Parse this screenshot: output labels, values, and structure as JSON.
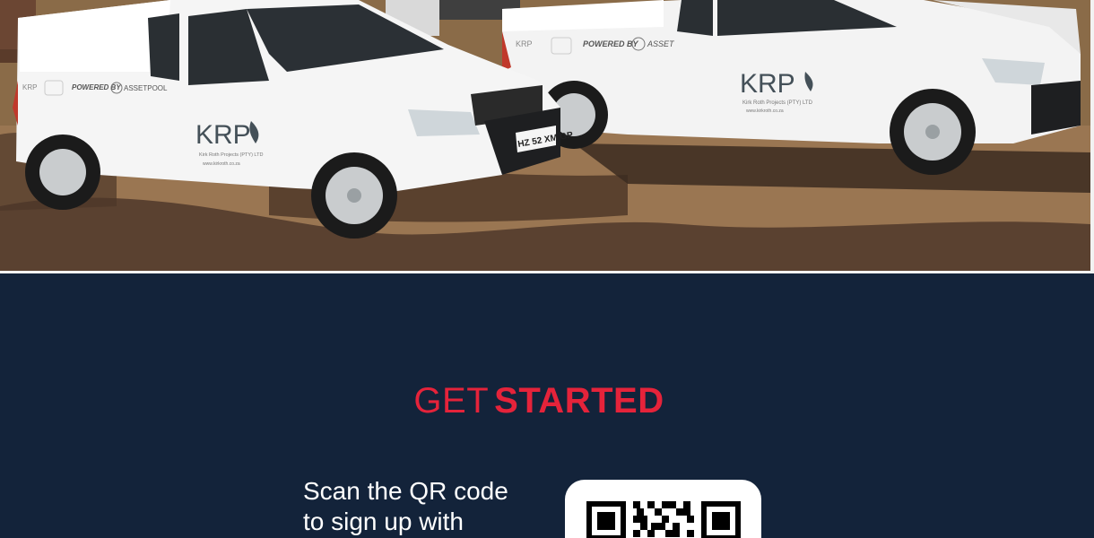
{
  "hero": {
    "vehicle_left": {
      "brand": "KRP",
      "company": "Kirk Roth Projects (PTY) LTD",
      "website": "www.kirkroth.co.za",
      "powered_by": "POWERED BY",
      "partner": "ASSETPOOL",
      "plate": "HZ 52 XM GP"
    },
    "vehicle_right": {
      "brand": "KRP",
      "company": "Kirk Roth Projects (PTY) LTD",
      "website": "www.kirkroth.co.za",
      "powered_by": "POWERED BY",
      "partner": "ASSET"
    }
  },
  "get_started": {
    "heading_light": "GET",
    "heading_bold": "STARTED",
    "scan_line_1": "Scan the QR code",
    "scan_line_2": "to sign up with",
    "accent_color": "#e5233a",
    "background_color": "#13233a"
  }
}
